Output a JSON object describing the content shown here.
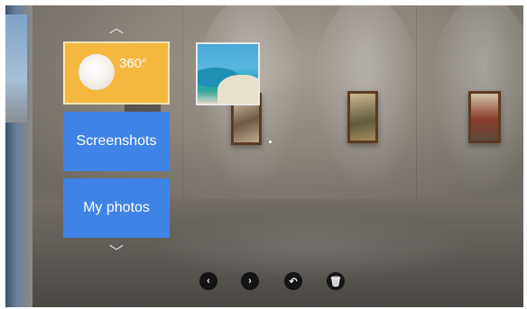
{
  "menu": {
    "tile_360_label": "360°",
    "screenshots_label": "Screenshots",
    "photos_label": "My photos",
    "scroll_up_icon": "chevron-up-icon",
    "scroll_down_icon": "chevron-down-icon"
  },
  "controls": [
    {
      "icon": "chevron-left-icon",
      "glyph": "‹"
    },
    {
      "icon": "chevron-right-icon",
      "glyph": "›"
    },
    {
      "icon": "undo-icon",
      "glyph": "↶"
    },
    {
      "icon": "trash-icon",
      "glyph": "🗑"
    }
  ],
  "colors": {
    "tile_360": "#f6b73f",
    "tile_blue": "#3f83e6"
  }
}
